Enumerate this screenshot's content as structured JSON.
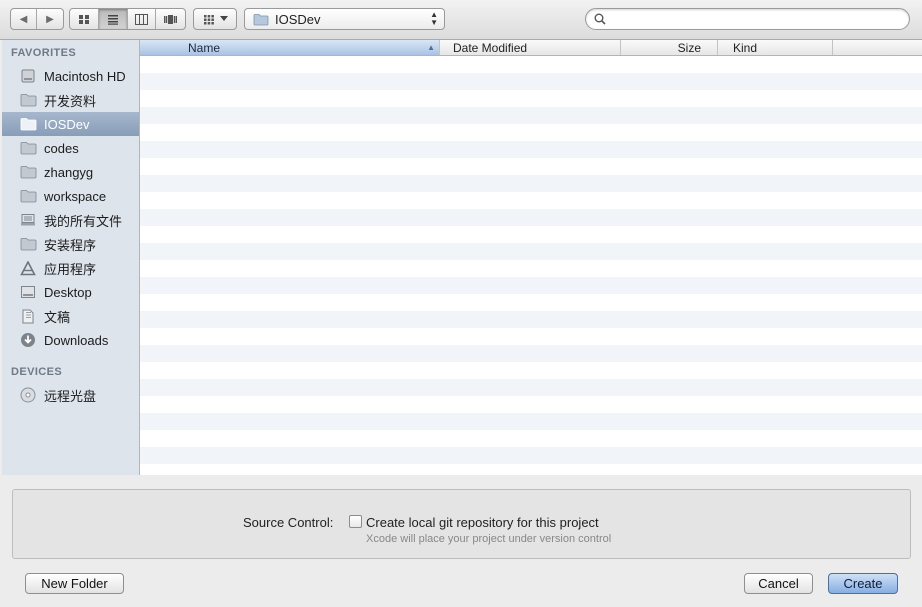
{
  "toolbar": {
    "back_glyph": "◀",
    "forward_glyph": "▶",
    "view_modes": [
      "icon-view-icon",
      "list-view-icon",
      "column-view-icon",
      "coverflow-view-icon"
    ],
    "active_view": "list",
    "path": {
      "label": "IOSDev",
      "icon": "folder-icon"
    },
    "search": {
      "value": "",
      "placeholder": ""
    }
  },
  "sidebar": {
    "favorites_header": "FAVORITES",
    "favorites": [
      {
        "label": "Macintosh HD",
        "icon": "hard-disk-icon"
      },
      {
        "label": "开发资料",
        "icon": "folder-icon"
      },
      {
        "label": "IOSDev",
        "icon": "folder-icon",
        "selected": true
      },
      {
        "label": "codes",
        "icon": "folder-icon"
      },
      {
        "label": "zhangyg",
        "icon": "folder-icon"
      },
      {
        "label": "workspace",
        "icon": "folder-icon"
      },
      {
        "label": "我的所有文件",
        "icon": "all-files-icon"
      },
      {
        "label": "安装程序",
        "icon": "folder-icon"
      },
      {
        "label": "应用程序",
        "icon": "applications-icon"
      },
      {
        "label": "Desktop",
        "icon": "desktop-icon"
      },
      {
        "label": "文稿",
        "icon": "documents-icon"
      },
      {
        "label": "Downloads",
        "icon": "downloads-icon"
      }
    ],
    "devices_header": "DEVICES",
    "devices": [
      {
        "label": "远程光盘",
        "icon": "optical-disc-icon"
      }
    ]
  },
  "filelist": {
    "columns": {
      "name": "Name",
      "date": "Date Modified",
      "size": "Size",
      "kind": "Kind"
    },
    "sorted_by": "name",
    "rows": []
  },
  "options": {
    "source_control_label": "Source Control:",
    "git_checkbox_label": "Create local git repository for this project",
    "git_checked": false,
    "hint": "Xcode will place your project under version control"
  },
  "buttons": {
    "new_folder": "New Folder",
    "cancel": "Cancel",
    "create": "Create"
  },
  "colors": {
    "sidebar_bg": "#dde4eb",
    "selection": "#8fa3be",
    "default_button": "#86aee2"
  }
}
